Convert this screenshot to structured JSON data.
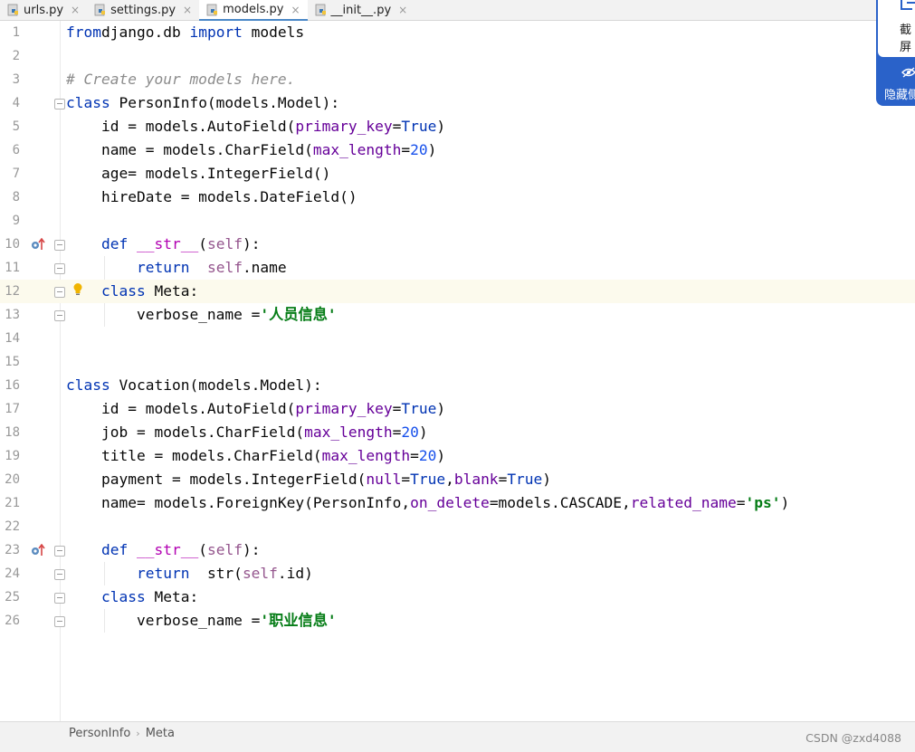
{
  "tabs": [
    {
      "label": "urls.py",
      "active": false
    },
    {
      "label": "settings.py",
      "active": false
    },
    {
      "label": "models.py",
      "active": true
    },
    {
      "label": "__init__.py",
      "active": false
    }
  ],
  "tab_close_glyph": "×",
  "code_lines": [
    {
      "num": "1",
      "tokens": [
        [
          "kw",
          "from"
        ],
        [
          "",
          "django.db "
        ],
        [
          "kw",
          "import"
        ],
        [
          "",
          " models"
        ]
      ]
    },
    {
      "num": "2",
      "tokens": []
    },
    {
      "num": "3",
      "tokens": [
        [
          "cm",
          "# Create your models here."
        ]
      ]
    },
    {
      "num": "4",
      "tokens": [
        [
          "kw",
          "class"
        ],
        [
          "",
          " PersonInfo(models.Model):"
        ]
      ]
    },
    {
      "num": "5",
      "tokens": [
        [
          "",
          "    id = models.AutoField("
        ],
        [
          "kwarg",
          "primary_key"
        ],
        [
          "",
          "="
        ],
        [
          "kw",
          "True"
        ],
        [
          "",
          ")"
        ]
      ]
    },
    {
      "num": "6",
      "tokens": [
        [
          "",
          "    name = models.CharField("
        ],
        [
          "kwarg",
          "max_length"
        ],
        [
          "",
          "="
        ],
        [
          "num",
          "20"
        ],
        [
          "",
          ")"
        ]
      ]
    },
    {
      "num": "7",
      "tokens": [
        [
          "",
          "    age= models.IntegerField()"
        ]
      ]
    },
    {
      "num": "8",
      "tokens": [
        [
          "",
          "    hireDate = models.DateField()"
        ]
      ]
    },
    {
      "num": "9",
      "tokens": []
    },
    {
      "num": "10",
      "tokens": [
        [
          "",
          "    "
        ],
        [
          "kw",
          "def"
        ],
        [
          "",
          " "
        ],
        [
          "dunder",
          "__str__"
        ],
        [
          "",
          "("
        ],
        [
          "self",
          "self"
        ],
        [
          "",
          "):"
        ]
      ]
    },
    {
      "num": "11",
      "tokens": [
        [
          "",
          "        "
        ],
        [
          "kw",
          "return"
        ],
        [
          "",
          "  "
        ],
        [
          "self",
          "self"
        ],
        [
          "",
          ".name"
        ]
      ]
    },
    {
      "num": "12",
      "tokens": [
        [
          "",
          "    "
        ],
        [
          "kw",
          "class"
        ],
        [
          "",
          " Meta:"
        ]
      ]
    },
    {
      "num": "13",
      "tokens": [
        [
          "",
          "        verbose_name ="
        ],
        [
          "str",
          "'人员信息'"
        ]
      ]
    },
    {
      "num": "14",
      "tokens": []
    },
    {
      "num": "15",
      "tokens": []
    },
    {
      "num": "16",
      "tokens": [
        [
          "kw",
          "class"
        ],
        [
          "",
          " Vocation(models.Model):"
        ]
      ]
    },
    {
      "num": "17",
      "tokens": [
        [
          "",
          "    id = models.AutoField("
        ],
        [
          "kwarg",
          "primary_key"
        ],
        [
          "",
          "="
        ],
        [
          "kw",
          "True"
        ],
        [
          "",
          ")"
        ]
      ]
    },
    {
      "num": "18",
      "tokens": [
        [
          "",
          "    job = models.CharField("
        ],
        [
          "kwarg",
          "max_length"
        ],
        [
          "",
          "="
        ],
        [
          "num",
          "20"
        ],
        [
          "",
          ")"
        ]
      ]
    },
    {
      "num": "19",
      "tokens": [
        [
          "",
          "    title = models.CharField("
        ],
        [
          "kwarg",
          "max_length"
        ],
        [
          "",
          "="
        ],
        [
          "num",
          "20"
        ],
        [
          "",
          ")"
        ]
      ]
    },
    {
      "num": "20",
      "tokens": [
        [
          "",
          "    payment = models.IntegerField("
        ],
        [
          "kwarg",
          "null"
        ],
        [
          "",
          "="
        ],
        [
          "kw",
          "True"
        ],
        [
          "",
          ","
        ],
        [
          "kwarg",
          "blank"
        ],
        [
          "",
          "="
        ],
        [
          "kw",
          "True"
        ],
        [
          "",
          ")"
        ]
      ]
    },
    {
      "num": "21",
      "tokens": [
        [
          "",
          "    name= models.ForeignKey(PersonInfo,"
        ],
        [
          "kwarg",
          "on_delete"
        ],
        [
          "",
          "=models.CASCADE,"
        ],
        [
          "kwarg",
          "related_name"
        ],
        [
          "",
          "="
        ],
        [
          "str",
          "'ps'"
        ],
        [
          "",
          ")"
        ]
      ]
    },
    {
      "num": "22",
      "tokens": []
    },
    {
      "num": "23",
      "tokens": [
        [
          "",
          "    "
        ],
        [
          "kw",
          "def"
        ],
        [
          "",
          " "
        ],
        [
          "dunder",
          "__str__"
        ],
        [
          "",
          "("
        ],
        [
          "self",
          "self"
        ],
        [
          "",
          "):"
        ]
      ]
    },
    {
      "num": "24",
      "tokens": [
        [
          "",
          "        "
        ],
        [
          "kw",
          "return"
        ],
        [
          "",
          "  str("
        ],
        [
          "self",
          "self"
        ],
        [
          "",
          ".id)"
        ]
      ]
    },
    {
      "num": "25",
      "tokens": [
        [
          "",
          "    "
        ],
        [
          "kw",
          "class"
        ],
        [
          "",
          " Meta:"
        ]
      ]
    },
    {
      "num": "26",
      "tokens": [
        [
          "",
          "        verbose_name ="
        ],
        [
          "str",
          "'职业信息'"
        ]
      ]
    }
  ],
  "current_line": "12",
  "side_panel": {
    "capture_label": "截屏",
    "hide_label": "隐藏侧栏"
  },
  "breadcrumb": [
    "PersonInfo",
    "Meta"
  ],
  "breadcrumb_sep": "›",
  "watermark": "CSDN @zxd4088",
  "colors": {
    "keyword": "#0033b3",
    "comment": "#8c8c8c",
    "kwarg": "#660099",
    "number": "#1750eb",
    "self": "#94558d",
    "string": "#067d17",
    "current_line_bg": "#fcfaed",
    "side_panel": "#2a62c9"
  }
}
